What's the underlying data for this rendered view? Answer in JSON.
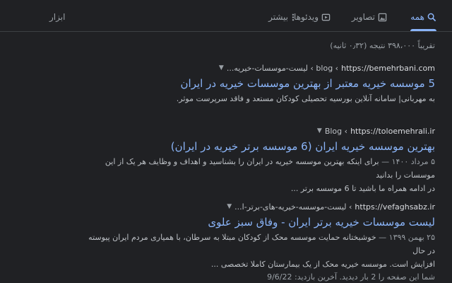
{
  "tabs": {
    "all": "همه",
    "images": "تصاویر",
    "videos": "ویدئوها",
    "more": "بیشتر",
    "tools": "ابزار"
  },
  "stats": "تقریباً ۳۹۸،۰۰۰ نتیجه (۰٫۳۲ ثانیه)",
  "results": [
    {
      "domain": "https://bemehrbani.com",
      "path": "› blog › لیست-موسسات-خیریه...",
      "title": "5 موسسه خیریه معتبر از بهترین موسسات خیریه در ایران",
      "snippet": "به مهربانی| سامانه آنلاین بورسیه تحصیلی کودکان مستعد و فاقد سرپرست موثر."
    },
    {
      "domain": "https://toloemehrali.ir",
      "path": "› Blog",
      "title": "بهترین موسسه خیریه ایران (6 موسسه برتر خیریه در ایران)",
      "date": "۵ مرداد ۱۴۰۰ —",
      "snippet_line1": "برای اینکه بهترین موسسه خیریه در ایران را بشناسید و اهداف و وظایف هر یک از این موسسات را بدانید",
      "snippet_line2": "در ادامه همراه ما باشید تا 6 موسسه برتر ..."
    },
    {
      "domain": "https://vefaghsabz.ir",
      "path": "› لیست-موسسه-خیریه-های-برتر-ا...",
      "title": "لیست موسسات خیریه برتر ایران - وفاق سبز علوی",
      "date": "۲۵ بهمن ۱۳۹۹ —",
      "snippet_line1": "خوشبختانه حمایت موسسه محک از کودکان مبتلا به سرطان، با همیاری مردم ایران پیوسته در حال",
      "snippet_line2": "افزایش است. موسسه خیریه محک از یک بیمارستان کاملا تخصصی ...",
      "visited": "شما این صفحه را 2 بار دیدید. آخرین بازدید: 9/6/22"
    }
  ],
  "colors": {
    "background": "#202124",
    "link": "#8ab4f8",
    "text": "#bdc1c6",
    "muted": "#9aa0a6"
  }
}
